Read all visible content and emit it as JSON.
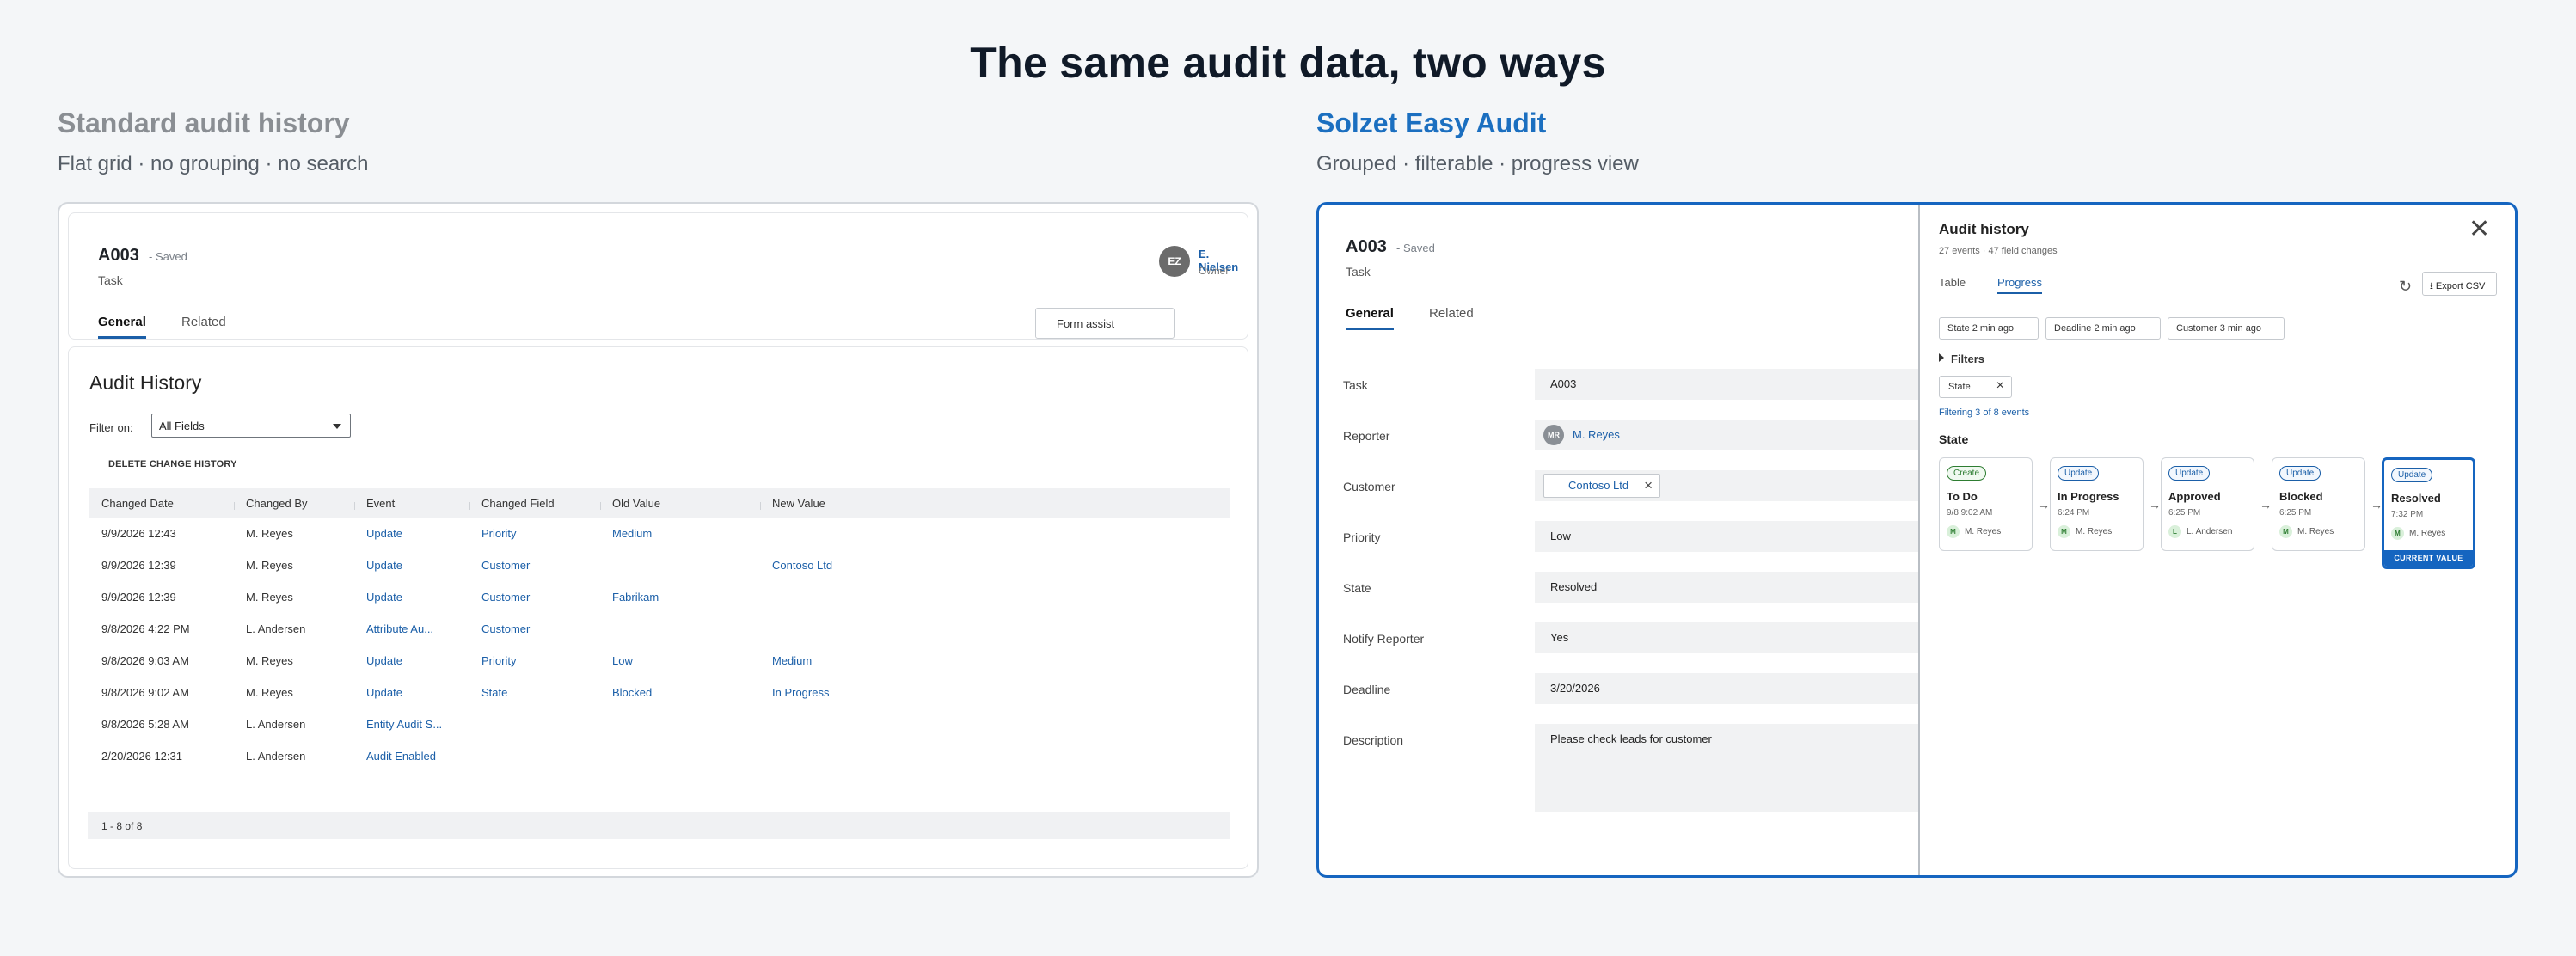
{
  "main_title": "The same audit data, two ways",
  "left": {
    "title": "Standard audit history",
    "subtitle": "Flat grid · no grouping · no search",
    "record": {
      "id": "A003",
      "saved": "- Saved",
      "type": "Task",
      "owner_initials": "EZ",
      "owner_name": "E. Nielsen",
      "owner_role": "Owner",
      "tabs": [
        "General",
        "Related"
      ],
      "form_assist": "Form assist"
    },
    "audit": {
      "title": "Audit History",
      "filter_label": "Filter on:",
      "filter_value": "All Fields",
      "delete_label": "DELETE CHANGE HISTORY",
      "columns": [
        "Changed Date",
        "Changed By",
        "Event",
        "Changed Field",
        "Old Value",
        "New Value"
      ],
      "rows": [
        [
          "9/9/2026 12:43",
          "M. Reyes",
          "Update",
          "Priority",
          "Medium",
          ""
        ],
        [
          "9/9/2026 12:39",
          "M. Reyes",
          "Update",
          "Customer",
          "",
          "Contoso Ltd"
        ],
        [
          "9/9/2026 12:39",
          "M. Reyes",
          "Update",
          "Customer",
          "Fabrikam",
          ""
        ],
        [
          "9/8/2026 4:22 PM",
          "L. Andersen",
          "Attribute Au...",
          "Customer",
          "",
          ""
        ],
        [
          "9/8/2026 9:03 AM",
          "M. Reyes",
          "Update",
          "Priority",
          "Low",
          "Medium"
        ],
        [
          "9/8/2026 9:02 AM",
          "M. Reyes",
          "Update",
          "State",
          "Blocked",
          "In Progress"
        ],
        [
          "9/8/2026 5:28 AM",
          "L. Andersen",
          "Entity Audit S...",
          "",
          "",
          ""
        ],
        [
          "2/20/2026 12:31",
          "L. Andersen",
          "Audit Enabled",
          "",
          "",
          ""
        ]
      ],
      "footer": "1 - 8 of 8"
    }
  },
  "right": {
    "title": "Solzet Easy Audit",
    "subtitle": "Grouped · filterable · progress view",
    "record": {
      "id": "A003",
      "saved": "- Saved",
      "type": "Task",
      "tabs": [
        "General",
        "Related"
      ]
    },
    "fields": {
      "task": {
        "label": "Task",
        "value": "A003"
      },
      "reporter": {
        "label": "Reporter",
        "value": "M. Reyes",
        "initials": "MR"
      },
      "customer": {
        "label": "Customer",
        "value": "Contoso Ltd"
      },
      "priority": {
        "label": "Priority",
        "value": "Low"
      },
      "state": {
        "label": "State",
        "value": "Resolved"
      },
      "notify": {
        "label": "Notify Reporter",
        "value": "Yes"
      },
      "deadline": {
        "label": "Deadline",
        "value": "3/20/2026"
      },
      "description": {
        "label": "Description",
        "value": "Please check leads for customer"
      }
    },
    "audit_panel": {
      "title": "Audit history",
      "subtitle": "27 events · 47 field changes",
      "close_glyph": "✕",
      "tabs": [
        "Table",
        "Progress"
      ],
      "refresh_glyph": "↻",
      "export_label": "⭳ Export CSV",
      "recent": [
        "State 2 min ago",
        "Deadline 2 min ago",
        "Customer 3 min ago"
      ],
      "filters_label": "Filters",
      "filter_chip": "State",
      "filtering_note": "Filtering 3 of 8 events",
      "section": "State",
      "stages": [
        {
          "badge": "Create",
          "name": "To Do",
          "time": "9/8 9:02 AM",
          "initial": "M",
          "user": "M. Reyes"
        },
        {
          "badge": "Update",
          "name": "In Progress",
          "time": "6:24 PM",
          "initial": "M",
          "user": "M. Reyes"
        },
        {
          "badge": "Update",
          "name": "Approved",
          "time": "6:25 PM",
          "initial": "L",
          "user": "L. Andersen"
        },
        {
          "badge": "Update",
          "name": "Blocked",
          "time": "6:25 PM",
          "initial": "M",
          "user": "M. Reyes"
        },
        {
          "badge": "Update",
          "name": "Resolved",
          "time": "7:32 PM",
          "initial": "M",
          "user": "M. Reyes"
        }
      ],
      "current_label": "CURRENT VALUE",
      "arrow_glyph": "→"
    }
  },
  "colors": {
    "accent": "#1565c0",
    "link": "#1b5fa8",
    "create_badge": "#2e7d32",
    "page_bg": "#f4f6f8"
  }
}
